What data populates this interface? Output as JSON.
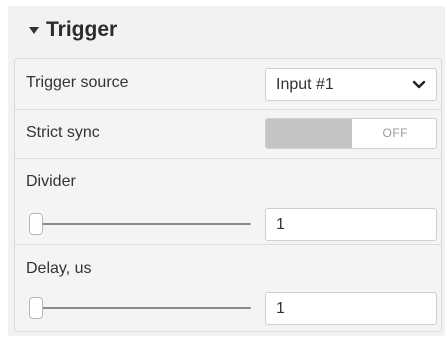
{
  "panel": {
    "title": "Trigger",
    "expanded": true
  },
  "rows": {
    "trigger_source": {
      "label": "Trigger source",
      "value": "Input #1"
    },
    "strict_sync": {
      "label": "Strict sync",
      "state": "OFF"
    },
    "divider": {
      "label": "Divider",
      "value": "1",
      "slider_fraction": 0
    },
    "delay": {
      "label": "Delay, us",
      "value": "1",
      "slider_fraction": 0
    }
  },
  "colors": {
    "panel_bg": "#f2f2f2",
    "toggle_off_fill": "#c4c4c4",
    "text": "#333333"
  },
  "icons": {
    "panel_caret": "caret-down-icon",
    "select_chevron": "chevron-down-icon"
  }
}
